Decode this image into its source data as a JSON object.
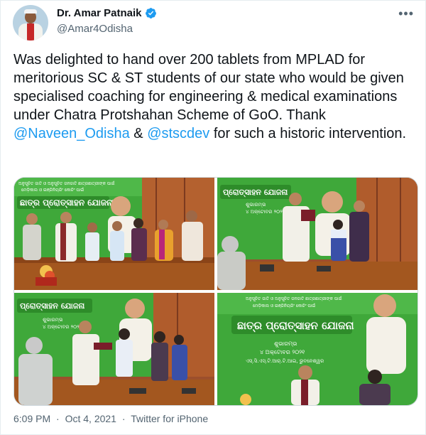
{
  "tweet": {
    "author_name": "Dr. Amar Patnaik",
    "author_handle": "@Amar4Odisha",
    "more_icon": "more-dots-icon",
    "text_before": "Was delighted to hand over 200 tablets from MPLAD for meritorious SC & ST students of our state who would be given specialised coaching for engineering & medical examinations under Chatra Protshahan Scheme of GoO. Thank ",
    "mention1": "@Naveen_Odisha",
    "text_mid": " & ",
    "mention2": "@stscdev",
    "text_after": " for such a historic intervention.",
    "time": "6:09 PM",
    "separator": "·",
    "date": "Oct 4, 2021",
    "source": "Twitter for iPhone"
  },
  "banner": {
    "scheme_title": "ଛାତ୍ର ପ୍ରୋତ୍ସାହନ ଯୋଜନା",
    "scheme_title_short": "ପ୍ରୋତ୍ସାହନ ଯୋଜନା",
    "line1": "ଶୁଭାରମ୍ଭ",
    "line2": "୪ ଅକ୍ଟୋବର ୨୦୨୧",
    "line3": "ଏସ୍.ସି.ଏସ୍.ଟି.ଆର୍.ଟି.ଆଇ, ଭୁବନେଶ୍ୱର",
    "top1": "ଅନୁସୂଚିତ ଜାତି ଓ ଅନୁସୂଚିତ ଜନଜାତି ଛାତ୍ରଛାତ୍ରୀଙ୍କ ପାଇଁ",
    "top2": "ମେଡ଼ିକାଲ ଓ ଇଞ୍ଜିନିୟରିଂ କୋଚିଂ ପାଇଁ"
  },
  "colors": {
    "mention": "#1d9bf0",
    "banner_green": "#3fa83a",
    "wall": "#a9552f",
    "table": "#a3571f"
  }
}
